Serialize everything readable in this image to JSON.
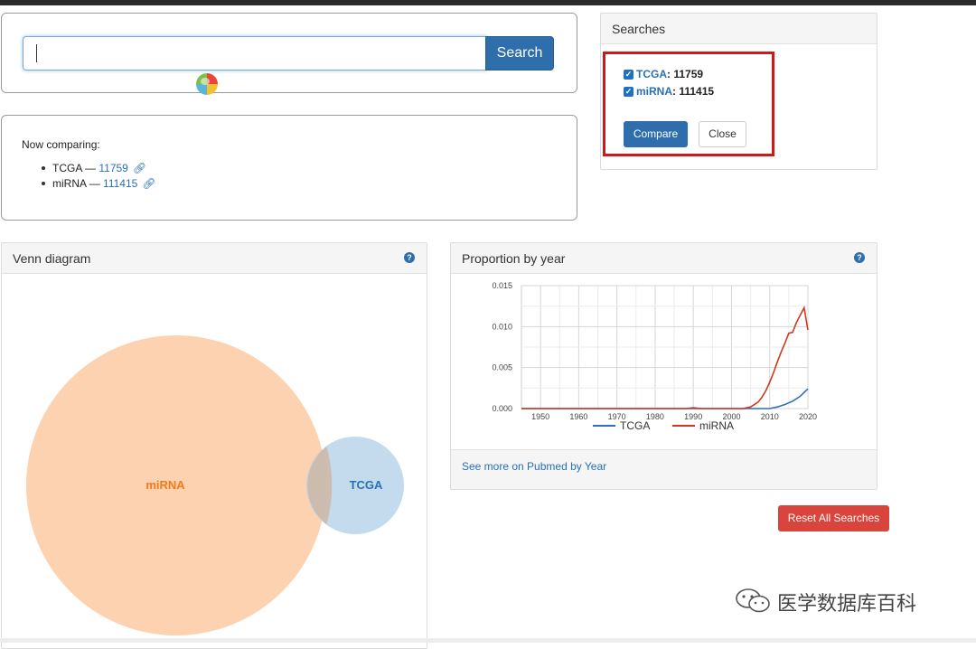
{
  "search": {
    "placeholder": "",
    "button_label": "Search"
  },
  "now_comparing": {
    "label": "Now comparing:",
    "items": [
      {
        "term": "TCGA",
        "sep": "—",
        "count": "11759"
      },
      {
        "term": "miRNA",
        "sep": "—",
        "count": "111415"
      }
    ]
  },
  "searches_panel": {
    "title": "Searches",
    "items": [
      {
        "term": "TCGA",
        "count": ": 11759",
        "checked": true
      },
      {
        "term": "miRNA",
        "count": ": 111415",
        "checked": true
      }
    ],
    "compare_label": "Compare",
    "close_label": "Close"
  },
  "venn": {
    "title": "Venn diagram",
    "help": "?",
    "sets": [
      {
        "label": "miRNA",
        "color": "#fdd0ac",
        "text_color": "#f07b1c"
      },
      {
        "label": "TCGA",
        "color": "#b9d5ea",
        "text_color": "#2a6fb5"
      }
    ]
  },
  "proportion": {
    "title": "Proportion by year",
    "help": "?",
    "footer_link": "See more on Pubmed by Year"
  },
  "reset_label": "Reset All Searches",
  "watermark": {
    "text": "医学数据库百科"
  },
  "chart_data": {
    "type": "line",
    "x_ticks": [
      "1950",
      "1960",
      "1970",
      "1980",
      "1990",
      "2000",
      "2010",
      "2020"
    ],
    "y_ticks": [
      "0.000",
      "0.005",
      "0.010",
      "0.015"
    ],
    "xlim": [
      1945,
      2020
    ],
    "ylim": [
      0,
      0.015
    ],
    "grid": true,
    "legend_position": "bottom",
    "series": [
      {
        "name": "TCGA",
        "color": "#2f6fba",
        "points": [
          [
            1945,
            0
          ],
          [
            1988,
            0
          ],
          [
            1990,
            0.0001
          ],
          [
            1992,
            0
          ],
          [
            2010,
            0
          ],
          [
            2012,
            0.0002
          ],
          [
            2014,
            0.0005
          ],
          [
            2016,
            0.0009
          ],
          [
            2018,
            0.0015
          ],
          [
            2020,
            0.0024
          ]
        ]
      },
      {
        "name": "miRNA",
        "color": "#d0391f",
        "points": [
          [
            1945,
            0
          ],
          [
            2003,
            0
          ],
          [
            2005,
            0.0002
          ],
          [
            2007,
            0.0008
          ],
          [
            2008,
            0.0014
          ],
          [
            2009,
            0.0022
          ],
          [
            2010,
            0.0032
          ],
          [
            2011,
            0.0044
          ],
          [
            2012,
            0.0057
          ],
          [
            2013,
            0.0069
          ],
          [
            2014,
            0.008
          ],
          [
            2015,
            0.0092
          ],
          [
            2016,
            0.0093
          ],
          [
            2017,
            0.0105
          ],
          [
            2018,
            0.0114
          ],
          [
            2019,
            0.0123
          ],
          [
            2020,
            0.0096
          ]
        ]
      }
    ]
  }
}
